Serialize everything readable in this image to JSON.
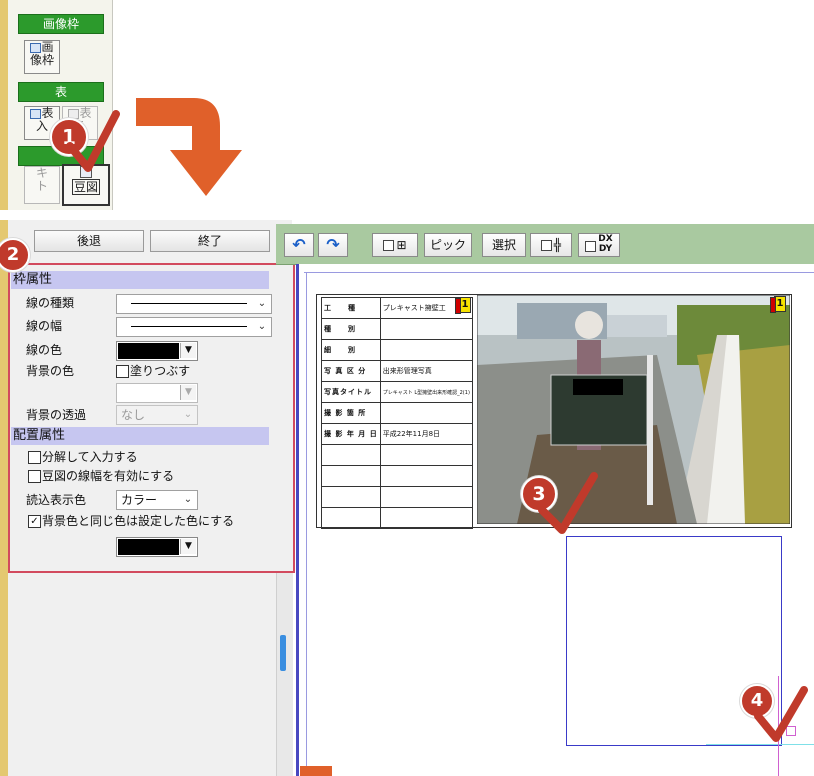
{
  "palette": {
    "header_frame": "画像枠",
    "tool_image_frame_l1": "画",
    "tool_image_frame_l2": "像枠",
    "header_table": "表",
    "tool_table_input_l1": "表",
    "tool_table_input_l2": "入",
    "tool_table_edit_l1": "表",
    "tool_table_edit_l2": "E",
    "tool_trim_l1": "キ",
    "tool_trim_l2": "ト",
    "tool_mamezu": "豆図"
  },
  "badges": {
    "step1": "1",
    "step2": "2",
    "step3": "3",
    "step4": "4"
  },
  "left_panel": {
    "back_button": "後退",
    "end_button": "終了"
  },
  "frame_properties": {
    "section_title": "枠属性",
    "line_type_label": "線の種類",
    "line_width_label": "線の幅",
    "line_color_label": "線の色",
    "bg_color_label": "背景の色",
    "fill_label": "塗りつぶす",
    "bg_transparency_label": "背景の透過",
    "bg_transparency_value": "なし"
  },
  "placement_properties": {
    "section_title": "配置属性",
    "decompose_label": "分解して入力する",
    "mamezu_width_label": "豆図の線幅を有効にする",
    "read_color_label": "読込表示色",
    "read_color_value": "カラー",
    "same_bg_color_label": "背景色と同じ色は設定した色にする",
    "same_bg_color_checked": true
  },
  "toolbar": {
    "undo": "↶",
    "redo": "↷",
    "pick": "ピック",
    "select": "選択",
    "dxdy_top": "DX",
    "dxdy_bottom": "DY"
  },
  "board": {
    "rows": [
      {
        "key": "工　　種",
        "value": "プレキャスト擁壁工"
      },
      {
        "key": "種　　別",
        "value": ""
      },
      {
        "key": "細　　別",
        "value": ""
      },
      {
        "key": "写 真 区 分",
        "value": "出来形管理写真"
      },
      {
        "key": "写真タイトル",
        "value": "プレキャスト L型擁壁出来形確認_2(1)"
      },
      {
        "key": "撮 影 箇 所",
        "value": ""
      },
      {
        "key": "撮 影 年 月 日",
        "value": "平成22年11月8日"
      },
      {
        "key": "",
        "value": ""
      },
      {
        "key": "",
        "value": ""
      },
      {
        "key": "",
        "value": ""
      },
      {
        "key": "",
        "value": ""
      }
    ],
    "tag_left": "1",
    "tag_right": "1"
  },
  "colors": {
    "accent_green": "#2c9a2c",
    "toolbar_green": "#a9c9a0",
    "section_lilac": "#c6c6f0",
    "highlight_red": "#d24a5e",
    "arrow_orange": "#e0602a",
    "badge_red": "#c03a2b"
  }
}
